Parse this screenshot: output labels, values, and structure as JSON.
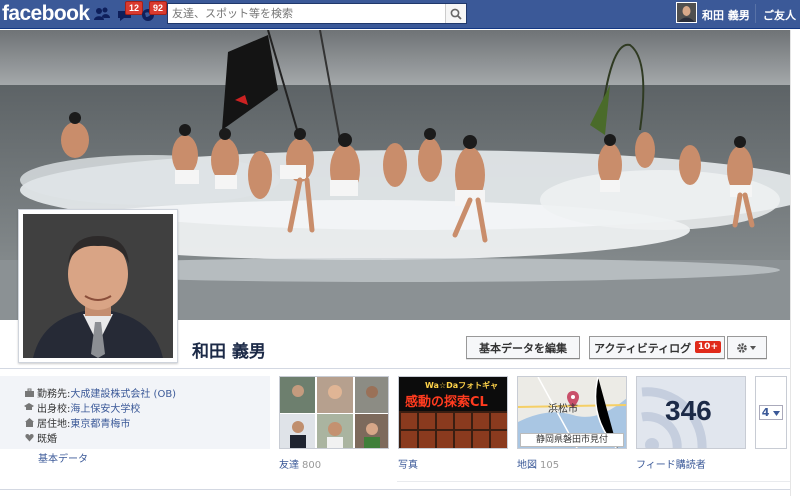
{
  "topbar": {
    "logo": "facebook",
    "friend_requests_badge": "",
    "messages_badge": "12",
    "notifications_badge": "92",
    "search_placeholder": "友達、スポット等を検索",
    "user_name": "和田 義男",
    "home_label": "ご友人"
  },
  "profile": {
    "name": "和田 義男",
    "edit_button": "基本データを編集",
    "activity_button": "アクティビティログ",
    "activity_badge": "10+"
  },
  "about": {
    "items": [
      {
        "icon": "briefcase-icon",
        "key": "勤務先: ",
        "value": "大成建設株式会社 (OB)"
      },
      {
        "icon": "graduation-cap-icon",
        "key": "出身校: ",
        "value": "海上保安大学校"
      },
      {
        "icon": "house-icon",
        "key": "居住地: ",
        "value": "東京都青梅市"
      },
      {
        "icon": "heart-icon",
        "key": "既婚",
        "value": ""
      }
    ],
    "link": "基本データ"
  },
  "tiles": {
    "friends": {
      "label": "友達",
      "count": "800"
    },
    "photos": {
      "label": "写真",
      "banner": "Wa☆Daフォトギャ",
      "caption": "感動の探索CL"
    },
    "map": {
      "label": "地図",
      "count": "105",
      "city_label": "浜松市",
      "caption": "静岡県磐田市見付"
    },
    "subscribers": {
      "label": "フィード購読者",
      "count": "346"
    },
    "more": {
      "badge": "4"
    }
  },
  "colors": {
    "topbar": "#3b5998",
    "link": "#3b5998",
    "badge": "#d93a2f"
  }
}
